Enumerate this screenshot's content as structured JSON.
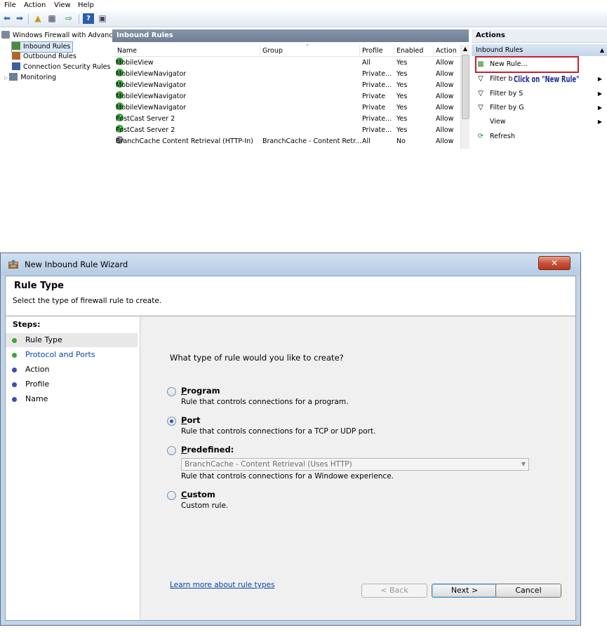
{
  "mmc": {
    "menu": [
      "File",
      "Action",
      "View",
      "Help"
    ],
    "tree": {
      "root": "Windows Firewall with Advance",
      "items": [
        "Inbound Rules",
        "Outbound Rules",
        "Connection Security Rules",
        "Monitoring"
      ]
    },
    "center": {
      "title": "Inbound Rules",
      "columns": [
        "Name",
        "Group",
        "Profile",
        "Enabled",
        "Action"
      ],
      "rows": [
        {
          "name": "MobileView",
          "group": "",
          "profile": "All",
          "enabled": "Yes",
          "action": "Allow"
        },
        {
          "name": "MobileViewNavigator",
          "group": "",
          "profile": "Private...",
          "enabled": "Yes",
          "action": "Allow"
        },
        {
          "name": "MobileViewNavigator",
          "group": "",
          "profile": "Private...",
          "enabled": "Yes",
          "action": "Allow"
        },
        {
          "name": "MobileViewNavigator",
          "group": "",
          "profile": "Private",
          "enabled": "Yes",
          "action": "Allow"
        },
        {
          "name": "MobileViewNavigator",
          "group": "",
          "profile": "Private",
          "enabled": "Yes",
          "action": "Allow"
        },
        {
          "name": "PostCast Server 2",
          "group": "",
          "profile": "Private...",
          "enabled": "Yes",
          "action": "Allow"
        },
        {
          "name": "PostCast Server 2",
          "group": "",
          "profile": "Private...",
          "enabled": "Yes",
          "action": "Allow"
        },
        {
          "name": "BranchCache Content Retrieval (HTTP-In)",
          "group": "BranchCache - Content Retr...",
          "profile": "All",
          "enabled": "No",
          "action": "Allow"
        }
      ]
    },
    "actions": {
      "title": "Actions",
      "section": "Inbound Rules",
      "items": [
        {
          "label": "New Rule...",
          "icon": "new-rule-icon"
        },
        {
          "label": "Filter b",
          "icon": "filter-icon"
        },
        {
          "label": "Filter by S",
          "icon": "filter-icon"
        },
        {
          "label": "Filter by G",
          "icon": "filter-icon"
        },
        {
          "label": "View",
          "icon": ""
        },
        {
          "label": "Refresh",
          "icon": "refresh-icon"
        }
      ],
      "callout": "Click on \"New Rule\""
    }
  },
  "wizard": {
    "title": "New Inbound Rule Wizard",
    "heading": "Rule Type",
    "subheading": "Select the type of firewall rule to create.",
    "steps_label": "Steps:",
    "steps": [
      "Rule Type",
      "Protocol and Ports",
      "Action",
      "Profile",
      "Name"
    ],
    "question": "What type of rule would you like to create?",
    "options": [
      {
        "title": "Program",
        "desc": "Rule that controls connections for a program."
      },
      {
        "title": "Port",
        "desc": "Rule that controls connections for a TCP or UDP port."
      },
      {
        "title": "Predefined:",
        "desc": "Rule that controls connections for a Windowe experience."
      },
      {
        "title": "Custom",
        "desc": "Custom rule."
      }
    ],
    "selected_option": "Port",
    "predefined_value": "BranchCache - Content Retrieval (Uses HTTP)",
    "learn_link": "Learn more about rule types",
    "buttons": {
      "back": "< Back",
      "next": "Next >",
      "cancel": "Cancel"
    },
    "colors": {
      "link": "#0645ad",
      "step_done": "#3aa43a",
      "step_pending": "#3b4db8",
      "highlight_box": "#c8202b",
      "callout_text": "#1a2c9c"
    }
  }
}
